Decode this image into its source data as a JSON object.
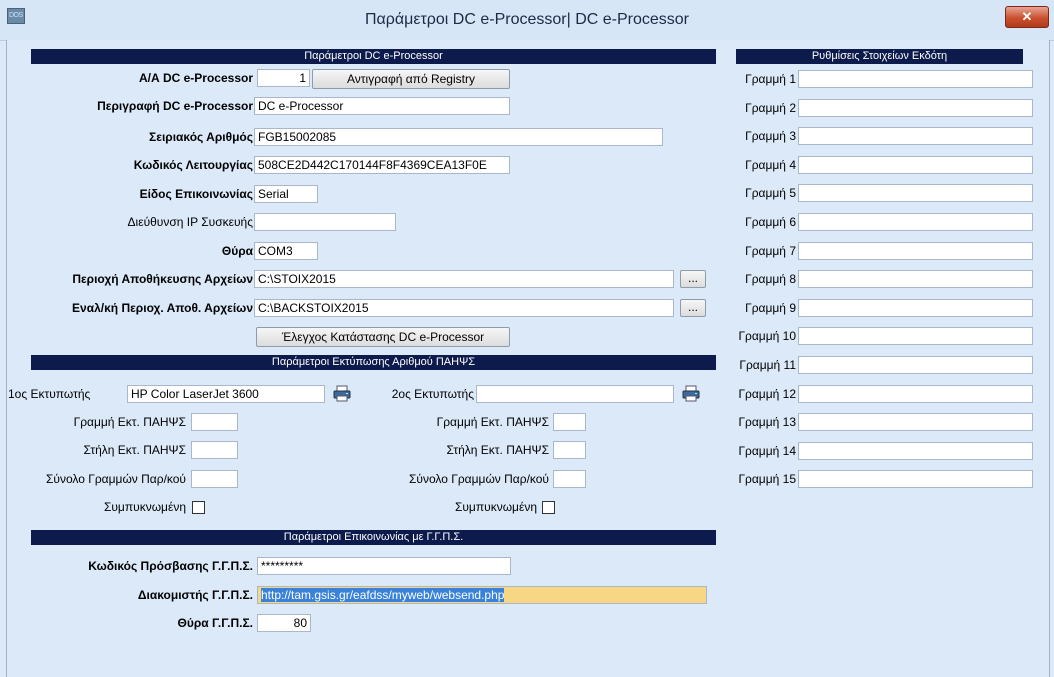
{
  "window": {
    "title": "Παράμετροι DC e-Processor| DC e-Processor",
    "app_icon_text": "DOS",
    "close_glyph": "✕"
  },
  "sections": {
    "dc": "Παράμετροι DC e-Processor",
    "print": "Παράμετροι Εκτύπωσης Αριθμού ΠΑΗΨΣ",
    "gsis": "Παράμετροι Επικοινωνίας με Γ.Γ.Π.Σ.",
    "issuer": "Ρυθμίσεις Στοιχείων Εκδότη"
  },
  "dc": {
    "aa_label": "Α/Α DC e-Processor",
    "aa_value": "1",
    "copy_button": "Αντιγραφή από Registry",
    "desc_label": "Περιγραφή DC e-Processor",
    "desc_value": "DC e-Processor",
    "serial_label": "Σειριακός Αριθμός",
    "serial_value": "FGB15002085",
    "code_label": "Κωδικός Λειτουργίας",
    "code_value": "508CE2D442C170144F8F4369CEA13F0E",
    "comm_label": "Είδος Επικοινωνίας",
    "comm_value": "Serial",
    "ip_label": "Διεύθυνση IP Συσκευής",
    "ip_value": "",
    "port_label": "Θύρα",
    "port_value": "COM3",
    "store_label": "Περιοχή Αποθήκευσης Αρχείων",
    "store_value": "C:\\STOIX2015",
    "alt_label": "Εναλ/κή Περιοχ. Αποθ. Αρχείων",
    "alt_value": "C:\\BACKSTOIX2015",
    "browse": "...",
    "check_button": "Έλεγχος Κατάστασης DC e-Processor"
  },
  "printers": {
    "p1": {
      "label": "1ος Εκτυπωτής",
      "value": "HP Color LaserJet 3600"
    },
    "p2": {
      "label": "2ος Εκτυπωτής",
      "value": ""
    },
    "line_label": "Γραμμή Εκτ. ΠΑΗΨΣ",
    "col_label": "Στήλη Εκτ. ΠΑΗΨΣ",
    "total_label": "Σύνολο Γραμμών Παρ/κού",
    "compact_label": "Συμπυκνωμένη"
  },
  "gsis": {
    "pass_label": "Κωδικός Πρόσβασης Γ.Γ.Π.Σ.",
    "pass_value": "*********",
    "server_label": "Διακομιστής Γ.Γ.Π.Σ.",
    "server_value": "http://tam.gsis.gr/eafdss/myweb/websend.php",
    "port_label": "Θύρα Γ.Γ.Π.Σ.",
    "port_value": "80"
  },
  "issuer_lines": [
    {
      "label": "Γραμμή 1",
      "value": ""
    },
    {
      "label": "Γραμμή 2",
      "value": ""
    },
    {
      "label": "Γραμμή 3",
      "value": ""
    },
    {
      "label": "Γραμμή 4",
      "value": ""
    },
    {
      "label": "Γραμμή 5",
      "value": ""
    },
    {
      "label": "Γραμμή 6",
      "value": ""
    },
    {
      "label": "Γραμμή 7",
      "value": ""
    },
    {
      "label": "Γραμμή 8",
      "value": ""
    },
    {
      "label": "Γραμμή 9",
      "value": ""
    },
    {
      "label": "Γραμμή 10",
      "value": ""
    },
    {
      "label": "Γραμμή 11",
      "value": ""
    },
    {
      "label": "Γραμμή 12",
      "value": ""
    },
    {
      "label": "Γραμμή 13",
      "value": ""
    },
    {
      "label": "Γραμμή 14",
      "value": ""
    },
    {
      "label": "Γραμμή 15",
      "value": ""
    }
  ]
}
